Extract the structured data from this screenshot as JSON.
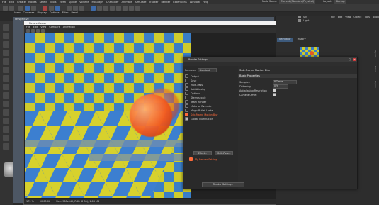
{
  "main_menu": [
    "File",
    "Edit",
    "Create",
    "Modes",
    "Select",
    "Tools",
    "Mesh",
    "Spline",
    "Volume",
    "MoGraph",
    "Character",
    "Animate",
    "Simulate",
    "Tracker",
    "Render",
    "Extensions",
    "Window",
    "Help"
  ],
  "top_right": {
    "node_space_label": "Node Space:",
    "node_space_value": "Current (Standard/Physical)",
    "layout_label": "Layout:",
    "layout_value": "Startup"
  },
  "viewport_menu": [
    "View",
    "Cameras",
    "Display",
    "Options",
    "Filter",
    "Panel"
  ],
  "viewport_label": "Perspective",
  "object_manager": {
    "menu": [
      "File",
      "Edit",
      "View",
      "Object",
      "Tags",
      "Bookmarks"
    ],
    "objects": [
      "Sky",
      "Light"
    ],
    "tabs": [
      "Navigator",
      "History"
    ]
  },
  "picture_viewer": {
    "title": "Picture Viewer",
    "menu": [
      "File",
      "Edit",
      "View",
      "Compare",
      "Animation"
    ],
    "status": {
      "zoom": "175 %",
      "time": "00:00:06",
      "size": "Size: 960x540, RGB (8 Bit), 1.63 MB"
    }
  },
  "render_settings": {
    "title": "Render Settings",
    "renderer_label": "Renderer",
    "renderer_value": "Standard",
    "items": [
      {
        "label": "Output",
        "state": "none"
      },
      {
        "label": "Save",
        "state": "none"
      },
      {
        "label": "Multi-Pass",
        "state": "none"
      },
      {
        "label": "Anti-Aliasing",
        "state": "none"
      },
      {
        "label": "Options",
        "state": "none"
      },
      {
        "label": "Stereoscopic",
        "state": "none"
      },
      {
        "label": "Team Render",
        "state": "none"
      },
      {
        "label": "Material Override",
        "state": "none"
      },
      {
        "label": "Magic Bullet Looks",
        "state": "none"
      },
      {
        "label": "Sub-Frame Motion Blur",
        "state": "active"
      },
      {
        "label": "Global Illumination",
        "state": "checked"
      }
    ],
    "effect_button": "Effect...",
    "multipass_button": "Multi-Pass...",
    "preset_label": "My Render Setting",
    "render_button": "Render Setting...",
    "panel_title": "Sub-Frame Motion Blur",
    "section": "Basic Properties",
    "props": [
      {
        "label": "Samples",
        "value": "8 Times"
      },
      {
        "label": "Dithering",
        "value": "0 %"
      },
      {
        "label": "Antialiasing Restriction",
        "value": "check"
      },
      {
        "label": "Camera Offset",
        "value": "check"
      }
    ]
  }
}
